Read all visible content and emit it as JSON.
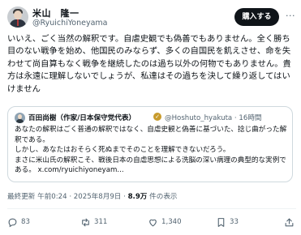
{
  "author": {
    "name": "米山　隆一",
    "handle": "@RyuichiYoneyama"
  },
  "header": {
    "subscribe_label": "購入する",
    "more_label": "···"
  },
  "post": {
    "text": "いいえ、ごく当然の解釈です。自虐史観でも偽善でもありません。全く勝ち目のない戦争を始め、他国民のみならず、多くの自国民を飢えさせ、命を失わせて尚自算もなく戦争を継続したのは過ち以外の何物でもありません。貴方は永遠に理解しないでしょうが、私達はその過ちを決して繰り返してはいけません"
  },
  "quote": {
    "name": "百田尚樹（作家/日本保守党代表）",
    "handle_time": "@Hoshuto_hyakuta · 16時間",
    "text": "あなたの解釈はごく普通の解釈ではなく、自虐史観と偽善に基づいた、捻じ曲がった解釈である。\nしかし、あなたはおそらく死ぬまでそのことを理解できないだろう。\nまさに米山氏の解釈こそ、戦後日本の自虐思想による洗脳の深い病理の典型的な実例である。 x.com/ryuichiyoneyam..."
  },
  "meta": {
    "timestamp": "最終更新 午前0:24 · 2025年8月9日 · ",
    "views_count": "8.9万",
    "views_label": " 件の表示"
  },
  "actions": {
    "replies": "83",
    "retweets": "311",
    "likes": "1,340",
    "bookmarks": "33"
  },
  "icons": {
    "reply": "speech-bubble-icon",
    "retweet": "retweet-arrows-icon",
    "like": "heart-icon",
    "bookmark": "bookmark-icon",
    "share": "share-upload-icon",
    "verified": "verified-badge-icon"
  },
  "colors": {
    "text": "#0f1419",
    "secondary": "#536471",
    "border": "#cfd9de",
    "verified_badge": "#c89b2c",
    "button": "#0f1419"
  }
}
